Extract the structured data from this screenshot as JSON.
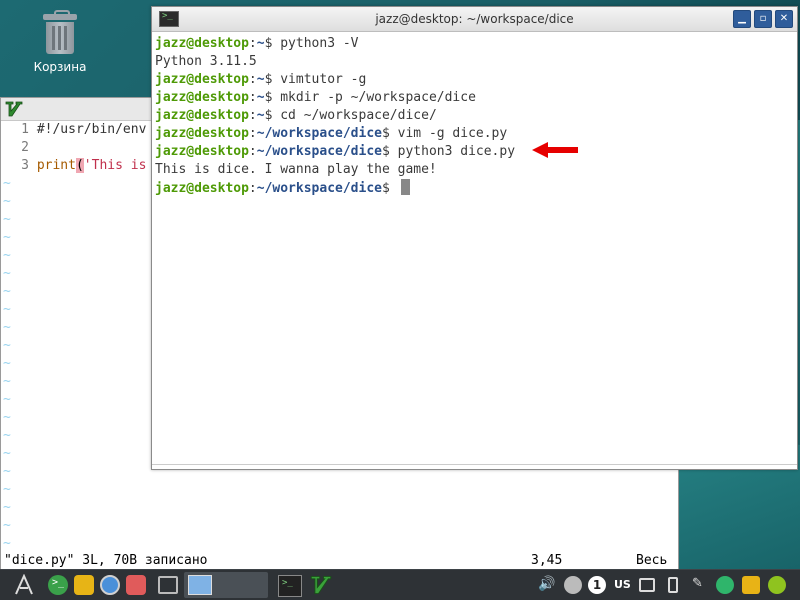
{
  "desktop": {
    "trash_label": "Корзина"
  },
  "terminal": {
    "title": "jazz@desktop: ~/workspace/dice",
    "lines": [
      {
        "user": "jazz@desktop",
        "path": "~",
        "cmd": " python3 -V"
      },
      {
        "output": "Python 3.11.5"
      },
      {
        "user": "jazz@desktop",
        "path": "~",
        "cmd": " vimtutor -g"
      },
      {
        "user": "jazz@desktop",
        "path": "~",
        "cmd": " mkdir -p ~/workspace/dice"
      },
      {
        "user": "jazz@desktop",
        "path": "~",
        "cmd": " cd ~/workspace/dice/"
      },
      {
        "user": "jazz@desktop",
        "path": "~/workspace/dice",
        "cmd": " vim -g dice.py"
      },
      {
        "user": "jazz@desktop",
        "path": "~/workspace/dice",
        "cmd": " python3 dice.py"
      },
      {
        "output": "This is dice. I wanna play the game!"
      },
      {
        "user": "jazz@desktop",
        "path": "~/workspace/dice",
        "cmd": " "
      }
    ]
  },
  "vim": {
    "line1": "#!/usr/bin/env",
    "line2": "",
    "line3_kw": "print",
    "line3_paren": "(",
    "line3_str": "'This is",
    "status_file": "\"dice.py\" 3L, 70B записано",
    "status_pos": "3,45",
    "status_scroll": "Весь"
  },
  "taskbar": {
    "keyboard_layout": "US",
    "workspace_number": "1",
    "accent_color": "#2e3236"
  }
}
